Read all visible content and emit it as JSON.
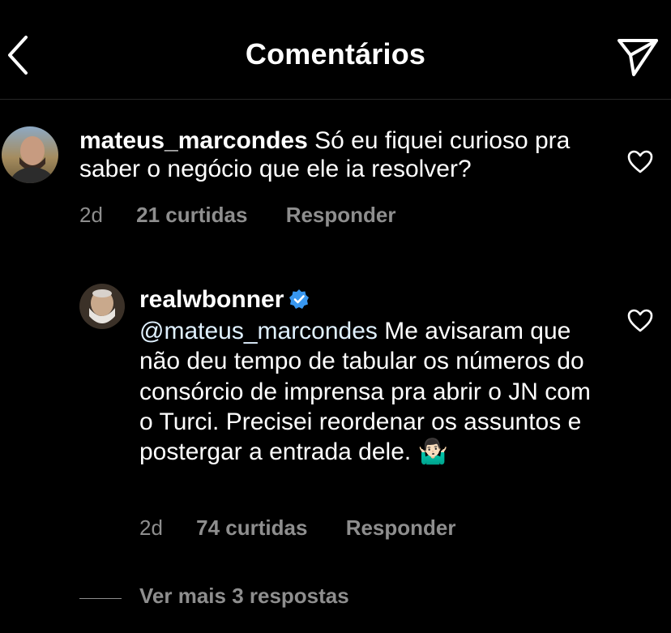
{
  "header": {
    "title": "Comentários",
    "back_icon": "chevron-left-icon",
    "share_icon": "paper-plane-icon"
  },
  "comments": [
    {
      "username": "mateus_marcondes",
      "text": "Só eu fiquei curioso pra saber o negócio que ele ia resolver?",
      "time": "2d",
      "likes": "21 curtidas",
      "reply_label": "Responder"
    },
    {
      "username": "realwbonner",
      "verified": true,
      "mention": "@mateus_marcondes",
      "text": "Me avisaram que não deu tempo de tabular os números do consórcio de imprensa pra abrir o JN com o Turci. Precisei reordenar os assuntos e postergar a entrada dele. 🤷🏻‍♂️",
      "time": "2d",
      "likes": "74 curtidas",
      "reply_label": "Responder"
    }
  ],
  "view_more": "Ver mais 3 respostas",
  "colors": {
    "background": "#000000",
    "text": "#ffffff",
    "secondary_text": "#8e8e8e",
    "verified_badge": "#3897f0",
    "divider": "#262626"
  }
}
